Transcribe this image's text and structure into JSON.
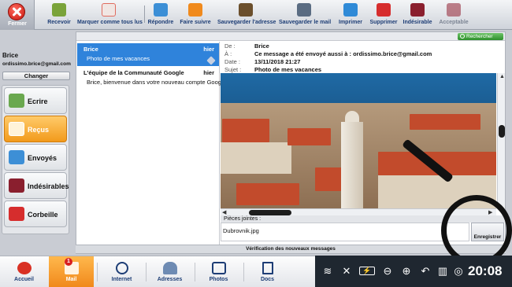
{
  "toolbar": {
    "close_label": "Fermer",
    "items": [
      {
        "label": "Recevoir",
        "icon": "inbox-receive-icon",
        "color": "#7aa33a"
      },
      {
        "label": "Marquer comme tous lus",
        "icon": "envelope-read-icon",
        "color": "#e06b5e"
      },
      {
        "label": "Répondre",
        "icon": "reply-icon",
        "color": "#3c8fd6"
      },
      {
        "label": "Faire suivre",
        "icon": "forward-icon",
        "color": "#f08a1d"
      },
      {
        "label": "Sauvegarder l'adresse",
        "icon": "address-book-icon",
        "color": "#6b4f2c"
      },
      {
        "label": "Sauvegarder le mail",
        "icon": "save-mail-icon",
        "color": "#5a6c82"
      },
      {
        "label": "Imprimer",
        "icon": "printer-icon",
        "color": "#2f8ad7"
      },
      {
        "label": "Supprimer",
        "icon": "trash-icon",
        "color": "#d62d2d"
      },
      {
        "label": "Indésirable",
        "icon": "spam-bin-icon",
        "color": "#8a1f2e"
      },
      {
        "label": "Acceptable",
        "icon": "accept-bin-icon",
        "color": "#a44b5a"
      }
    ]
  },
  "account": {
    "name": "Brice",
    "email": "ordissimo.brice@gmail.com",
    "change_label": "Changer"
  },
  "folders": [
    {
      "label": "Ecrire",
      "icon": "compose-icon",
      "color": "#6aa84f",
      "active": false
    },
    {
      "label": "Reçus",
      "icon": "inbox-icon",
      "color": "#f29a1b",
      "active": true
    },
    {
      "label": "Envoyés",
      "icon": "sent-icon",
      "color": "#3d8fd6",
      "active": false
    },
    {
      "label": "Indésirables",
      "icon": "spam-icon",
      "color": "#8a1f2e",
      "active": false
    },
    {
      "label": "Corbeille",
      "icon": "trash-icon",
      "color": "#d62d2d",
      "active": false
    }
  ],
  "search": {
    "label": "Rechercher"
  },
  "messages": [
    {
      "from": "Brice",
      "date": "hier",
      "subject": "Photo de mes vacances"
    },
    {
      "from": "L'équipe de la Communauté Google",
      "date": "hier",
      "subject": "Brice, bienvenue dans votre nouveau compte Google"
    }
  ],
  "message_view": {
    "from_label": "De :",
    "from": "Brice",
    "to_label": "À :",
    "to": "Ce message a été envoyé aussi à : ordissimo.brice@gmail.com",
    "date_label": "Date :",
    "date": "13/11/2018 21:27",
    "subject_label": "Sujet :",
    "subject": "Photo de mes vacances"
  },
  "attachments": {
    "header": "Pièces jointes :",
    "file": "Dubrovnik.jpg",
    "save_label": "Enregistrer"
  },
  "status": {
    "text": "Vérification des nouveaux messages"
  },
  "taskbar": {
    "items": [
      {
        "label": "Accueil",
        "icon": "home-icon"
      },
      {
        "label": "Mail",
        "icon": "mail-icon",
        "badge": "1"
      },
      {
        "label": "Internet",
        "icon": "globe-icon"
      },
      {
        "label": "Adresses",
        "icon": "contacts-icon"
      },
      {
        "label": "Photos",
        "icon": "camera-icon"
      },
      {
        "label": "Docs",
        "icon": "documents-icon"
      }
    ],
    "clock": "20:08"
  }
}
